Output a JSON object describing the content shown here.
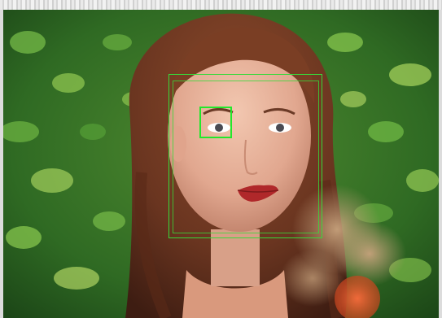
{
  "viewer": {
    "photo_alt": "",
    "overlay_color_face": "#37d93a",
    "overlay_color_eye": "#22e82b"
  }
}
